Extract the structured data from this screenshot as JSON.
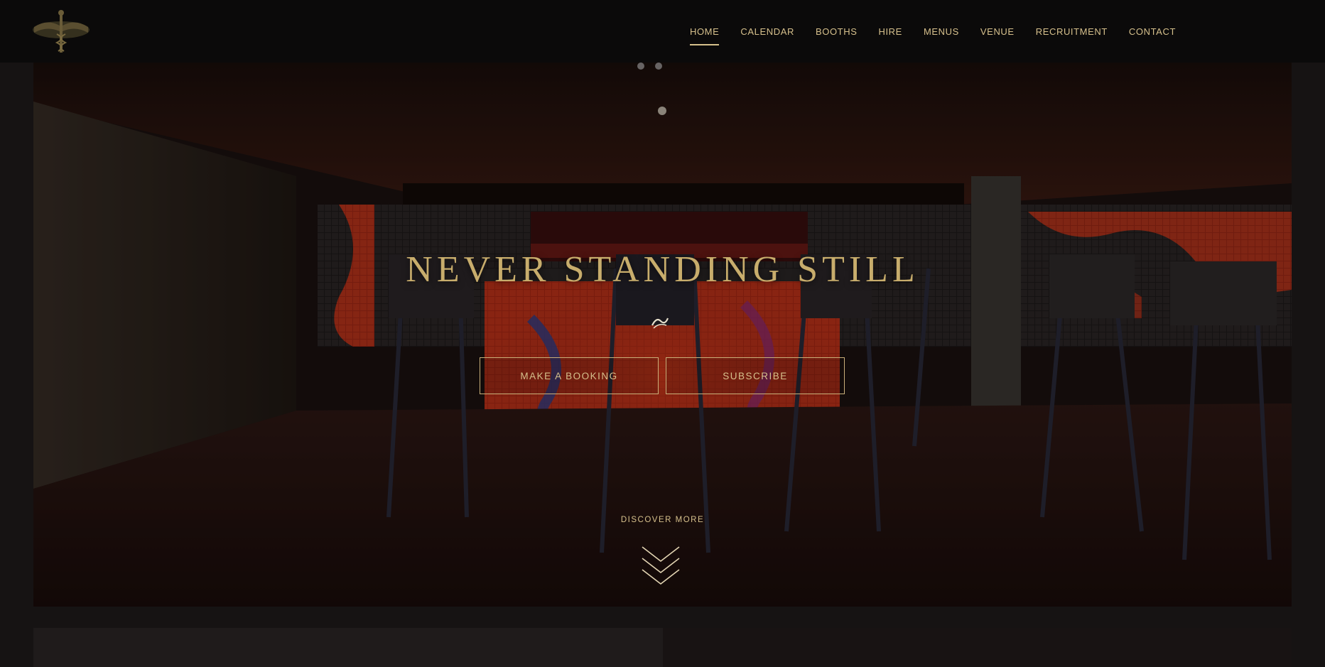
{
  "header": {
    "logo_icon": "caduceus-logo-icon",
    "nav": [
      {
        "label": "HOME",
        "active": true
      },
      {
        "label": "CALENDAR",
        "active": false
      },
      {
        "label": "BOOTHS",
        "active": false
      },
      {
        "label": "HIRE",
        "active": false
      },
      {
        "label": "MENUS",
        "active": false
      },
      {
        "label": "VENUE",
        "active": false
      },
      {
        "label": "RECRUITMENT",
        "active": false
      },
      {
        "label": "CONTACT",
        "active": false
      }
    ]
  },
  "hero": {
    "title": "NEVER STANDING STILL",
    "buttons": {
      "booking": "MAKE A BOOKING",
      "subscribe": "SUBSCRIBE"
    },
    "discover": "DISCOVER MORE",
    "scroll_icon": "chevron-down-triple-icon"
  },
  "colors": {
    "accent_gold": "#d6c08c",
    "header_bg": "#0b0a0a",
    "page_bg": "#161313"
  }
}
